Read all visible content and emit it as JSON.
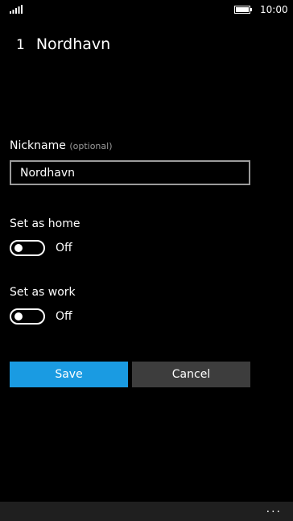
{
  "status_bar": {
    "time": "10:00",
    "signal_icon": "signal-bars-icon",
    "battery_icon": "battery-icon"
  },
  "header": {
    "index": "1",
    "title": "Nordhavn"
  },
  "form": {
    "nickname_label": "Nickname",
    "nickname_hint": "(optional)",
    "nickname_value": "Nordhavn",
    "home_label": "Set as home",
    "home_state": "Off",
    "work_label": "Set as work",
    "work_state": "Off"
  },
  "buttons": {
    "save": "Save",
    "cancel": "Cancel"
  },
  "app_bar": {
    "more_label": "..."
  },
  "colors": {
    "accent": "#1a9be2",
    "cancel_bg": "#3d3d3d",
    "background": "#000000",
    "app_bar": "#1f1f1f"
  }
}
